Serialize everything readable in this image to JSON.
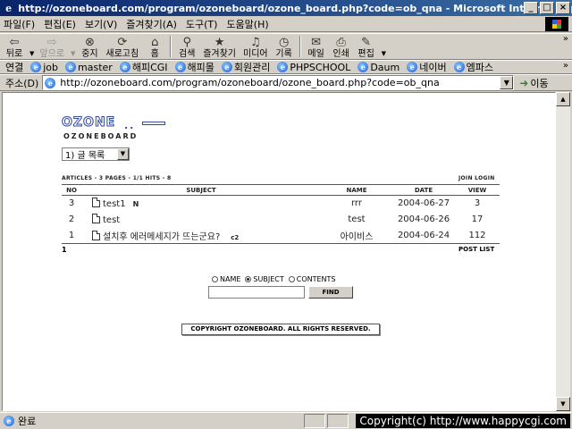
{
  "window": {
    "title": "http://ozoneboard.com/program/ozoneboard/ozone_board.php?code=ob_qna - Microsoft Internet Explorer",
    "buttons": [
      "_",
      "□",
      "×"
    ]
  },
  "menu": [
    "파일(F)",
    "편집(E)",
    "보기(V)",
    "즐겨찾기(A)",
    "도구(T)",
    "도움말(H)"
  ],
  "toolbar": {
    "back": "뒤로",
    "forward": "앞으로",
    "stop": "중지",
    "refresh": "새로고침",
    "home": "홈",
    "search": "검색",
    "favorites": "즐겨찾기",
    "media": "미디어",
    "history": "기록",
    "mail": "메일",
    "print": "인쇄",
    "edit": "편집",
    "chevron": "»"
  },
  "links": {
    "label": "연결",
    "items": [
      "job",
      "master",
      "해피CGI",
      "해피몰",
      "회원관리",
      "PHPSCHOOL",
      "Daum",
      "네이버",
      "엠파스"
    ],
    "chevron": "»"
  },
  "address": {
    "label": "주소(D)",
    "url": "http://ozoneboard.com/program/ozoneboard/ozone_board.php?code=ob_qna",
    "go": "이동"
  },
  "page": {
    "logo_word": "OZONE",
    "logo_dots": "..",
    "logo_text": "OZONEBOARD",
    "select_value": "1) 글 목록",
    "meta_left": "ARTICLES - 3 PAGES - 1/1 HITS - 8",
    "meta_right": "JOIN LOGIN",
    "columns": {
      "no": "NO",
      "subject": "SUBJECT",
      "name": "NAME",
      "date": "DATE",
      "view": "VIEW"
    },
    "rows": [
      {
        "no": "3",
        "subject": "test1",
        "mark": "N",
        "comments": "",
        "name": "rrr",
        "date": "2004-06-27",
        "view": "3"
      },
      {
        "no": "2",
        "subject": "test",
        "mark": "",
        "comments": "",
        "name": "test",
        "date": "2004-06-26",
        "view": "17"
      },
      {
        "no": "1",
        "subject": "설치후 에러메세지가 뜨는군요?",
        "mark": "",
        "comments": "c2",
        "name": "아이비스",
        "date": "2004-06-24",
        "view": "112"
      }
    ],
    "pager": "1",
    "post_list": "POST LIST",
    "search_opts": [
      "NAME",
      "SUBJECT",
      "CONTENTS"
    ],
    "find": "FIND",
    "copyright": "COPYRIGHT OZONEBOARD. ALL RIGHTS RESERVED."
  },
  "status": {
    "text": "완료",
    "overlay": "Copyright(c) http://www.happycgi.com"
  }
}
